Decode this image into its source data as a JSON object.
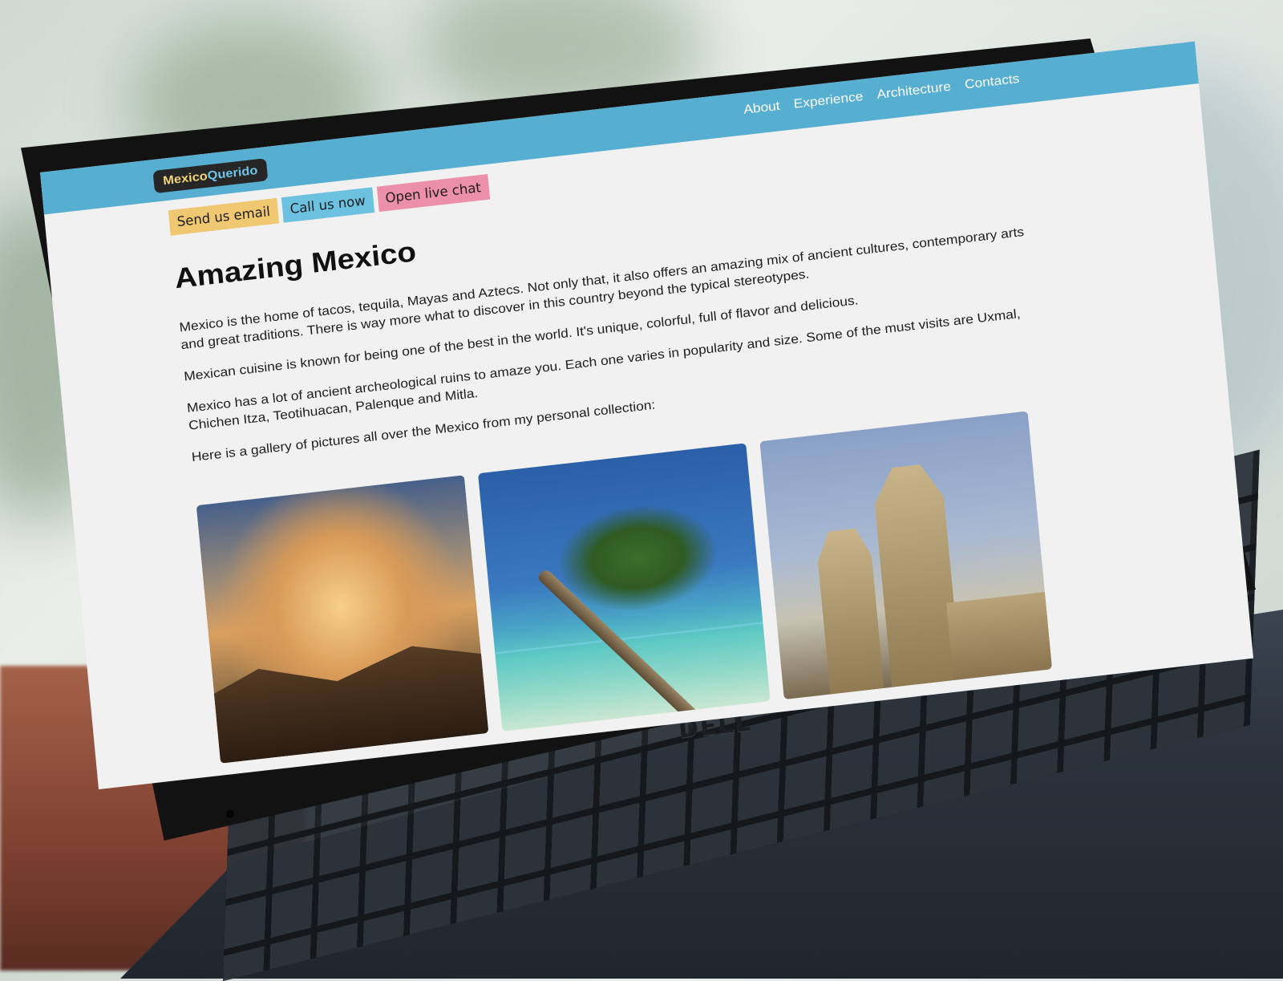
{
  "site": {
    "logo": {
      "part_a": "Mexico",
      "part_b": "Querido"
    },
    "nav": [
      "About",
      "Experience",
      "Architecture",
      "Contacts"
    ],
    "cta": {
      "email": "Send us email",
      "call": "Call us now",
      "chat": "Open live chat"
    }
  },
  "article": {
    "title": "Amazing Mexico",
    "paragraphs": [
      "Mexico is the home of tacos, tequila, Mayas and Aztecs. Not only that, it also offers an amazing mix of ancient cultures, contemporary arts and great traditions. There is way more what to discover in this country beyond the typical stereotypes.",
      "Mexican cuisine is known for being one of the best in the world. It's unique, colorful, full of flavor and delicious.",
      "Mexico has a lot of ancient archeological ruins to amaze you. Each one varies in popularity and size. Some of the must visits are Uxmal, Chichen Itza, Teotihuacan, Palenque and Mitla.",
      "Here is a gallery of pictures all over the Mexico from my personal collection:"
    ]
  },
  "gallery": [
    "sunset-mountains-photo",
    "palm-beach-photo",
    "cathedral-photo"
  ],
  "laptop": {
    "brand": "DELL"
  },
  "colors": {
    "topbar": "#56aed1",
    "email": "#efc871",
    "call": "#6cc0e0",
    "chat": "#ec8faa"
  }
}
